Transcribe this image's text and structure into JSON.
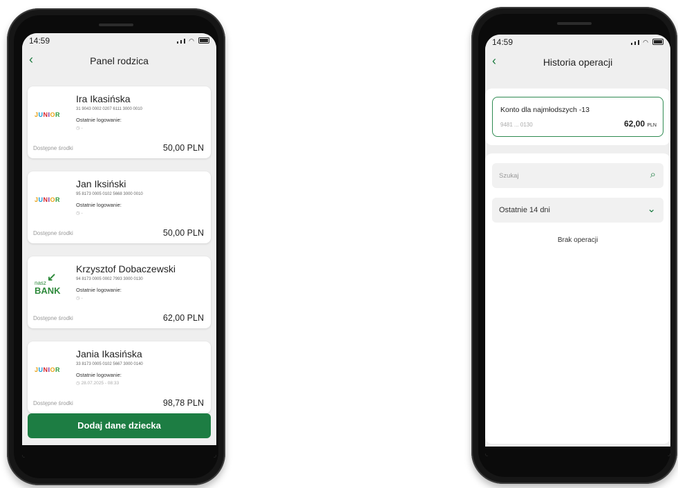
{
  "left": {
    "status_time": "14:59",
    "title": "Panel rodzica",
    "cards": [
      {
        "name": "Ira Ikasińska",
        "account": "31 9043 0002 0207 6111 3000 0010",
        "last_login_label": "Ostatnie logowanie:",
        "last_login": "-",
        "available_label": "Dostępne środki",
        "amount": "50,00 PLN",
        "logo": "JUNIOR"
      },
      {
        "name": "Jan Iksiński",
        "account": "95 8173 0005 0102 5668 3000 0010",
        "last_login_label": "Ostatnie logowanie:",
        "last_login": "-",
        "available_label": "Dostępne środki",
        "amount": "50,00 PLN",
        "logo": "JUNIOR"
      },
      {
        "name": "Krzysztof Dobaczewski",
        "account": "94 8173 0005 0002 7993 3000 0130",
        "last_login_label": "Ostatnie logowanie:",
        "last_login": "-",
        "available_label": "Dostępne środki",
        "amount": "62,00 PLN",
        "logo": "nasz BANK"
      },
      {
        "name": "Jania Ikasińska",
        "account": "33 8173 0005 0102 5667 3000 0140",
        "last_login_label": "Ostatnie logowanie:",
        "last_login": "28.07.2025 - 08:33",
        "available_label": "Dostępne środki",
        "amount": "98,78 PLN",
        "logo": "JUNIOR"
      }
    ],
    "add_button": "Dodaj dane dziecka"
  },
  "right": {
    "status_time": "14:59",
    "title": "Historia operacji",
    "account": {
      "name": "Konto dla najmłodszych -13",
      "number": "9481 ... 0130",
      "amount": "62,00",
      "currency": "PLN"
    },
    "search_placeholder": "Szukaj",
    "period": "Ostatnie 14 dni",
    "empty_text": "Brak operacji"
  }
}
